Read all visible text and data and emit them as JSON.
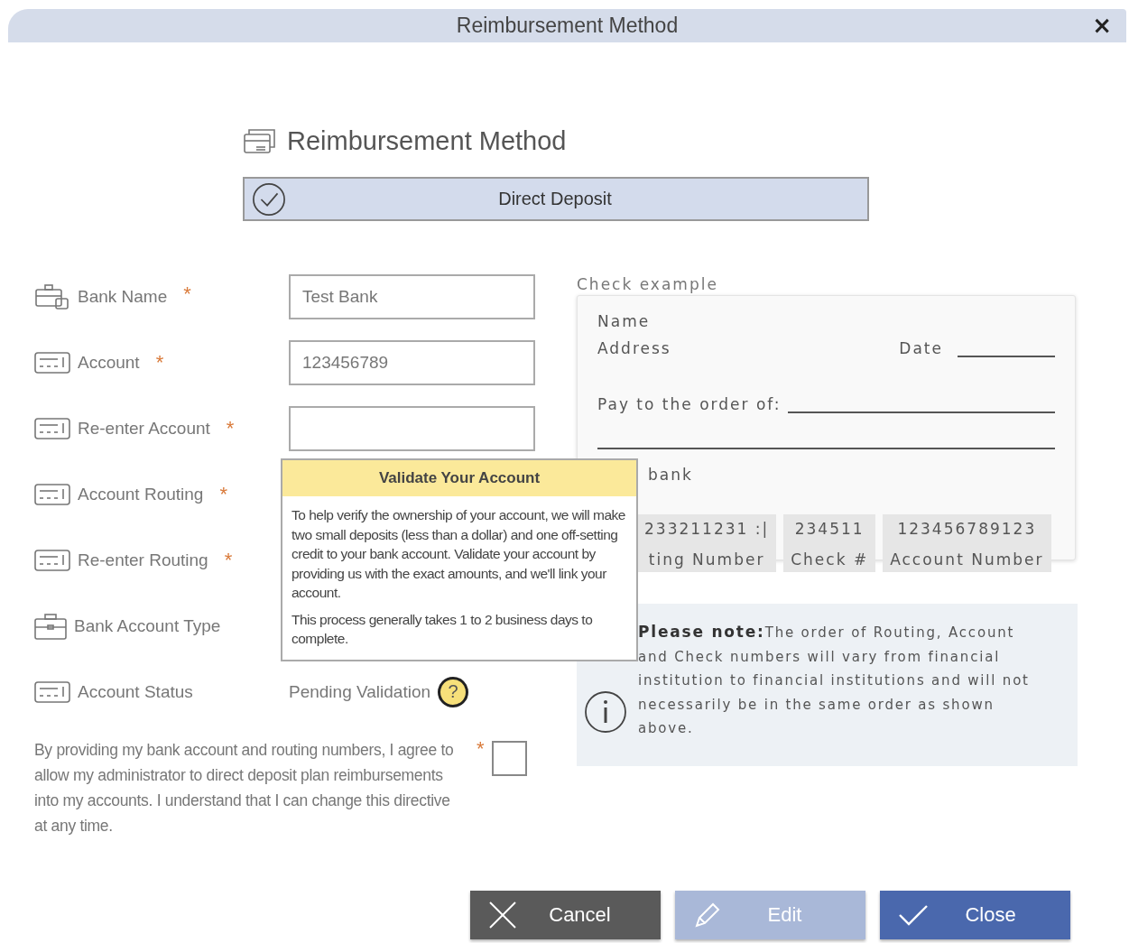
{
  "window": {
    "title": "Reimbursement Method",
    "close": "×"
  },
  "heading": "Reimbursement Method",
  "method": {
    "label": "Direct Deposit",
    "selected": true
  },
  "fields": [
    {
      "label": "Bank Name",
      "required_mark": "*",
      "kind": "input",
      "value": "Test Bank"
    },
    {
      "label": "Account",
      "required_mark": "*",
      "kind": "input",
      "value": "123456789"
    },
    {
      "label": "Re-enter Account",
      "required_mark": "*",
      "kind": "input"
    },
    {
      "label": "Account Routing",
      "required_mark": "*",
      "kind": "none"
    },
    {
      "label": "Re-enter Routing",
      "required_mark": "*",
      "kind": "none"
    },
    {
      "label": "Bank Account Type",
      "kind": "none"
    },
    {
      "label": "Account Status",
      "kind": "status",
      "value": "Pending Validation",
      "help": "?"
    }
  ],
  "popup": {
    "title": "Validate Your Account",
    "paragraphs": [
      "To help verify the ownership of your account, we will make two small deposits (less than a dollar) and one off-setting credit to your bank account. Validate your account by providing us with the exact amounts, and we'll link your account.",
      "This process generally takes 1 to 2 business days to complete."
    ]
  },
  "consent": {
    "text": "By providing my bank account and routing numbers, I agree to allow my administrator to direct deposit plan reimbursements into my accounts. I understand that I can change this directive at any time.",
    "required_mark": "*",
    "checked": false
  },
  "check_example": {
    "label": "Check example",
    "name": "Name",
    "address": "Address",
    "date": "Date",
    "pay_to": "Pay to the order of:",
    "bank": "bank",
    "numbers": [
      {
        "value": "233211231 :|",
        "caption": "ting Number"
      },
      {
        "value": "234511",
        "caption": "Check #"
      },
      {
        "value": "123456789123",
        "caption": "Account Number"
      }
    ]
  },
  "note": {
    "text": "**Please note:**The order of Routing, Account and Check numbers will vary from financial institution to financial institutions and will not necessarily be in the same order as shown above."
  },
  "buttons": [
    {
      "label": "Cancel",
      "kind": "cancel",
      "disabled": false
    },
    {
      "label": "Edit",
      "kind": "edit",
      "disabled": true
    },
    {
      "label": "Close",
      "kind": "close",
      "disabled": false
    }
  ]
}
